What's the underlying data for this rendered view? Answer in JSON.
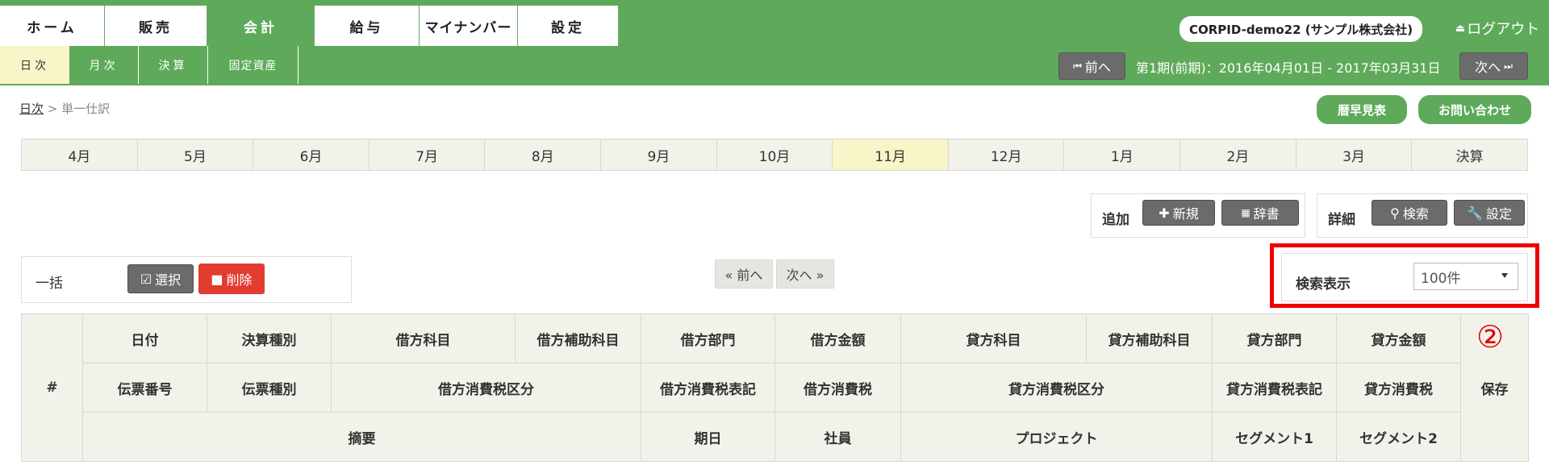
{
  "main_tabs": [
    {
      "label": "ホーム",
      "active": false
    },
    {
      "label": "販売",
      "active": false
    },
    {
      "label": "会計",
      "active": true
    },
    {
      "label": "給与",
      "active": false
    },
    {
      "label": "マイナンバー",
      "active": false
    },
    {
      "label": "設定",
      "active": false
    }
  ],
  "user": "CORPID-demo22 (サンプル株式会社)",
  "logout": "ログアウト",
  "sub_tabs": [
    {
      "label": "日次",
      "active": true
    },
    {
      "label": "月次",
      "active": false
    },
    {
      "label": "決算",
      "active": false
    },
    {
      "label": "固定資産",
      "active": false
    }
  ],
  "period": {
    "prev": "前へ",
    "text": "第1期(前期)：2016年04月01日 - 2017年03月31日",
    "next": "次へ"
  },
  "breadcrumb": {
    "link": "日次",
    "sep": ">",
    "current": "単一仕訳"
  },
  "header_buttons": {
    "calendar": "暦早見表",
    "contact": "お問い合わせ"
  },
  "months": [
    {
      "label": "4月",
      "active": false
    },
    {
      "label": "5月",
      "active": false
    },
    {
      "label": "6月",
      "active": false
    },
    {
      "label": "7月",
      "active": false
    },
    {
      "label": "8月",
      "active": false
    },
    {
      "label": "9月",
      "active": false
    },
    {
      "label": "10月",
      "active": false
    },
    {
      "label": "11月",
      "active": true
    },
    {
      "label": "12月",
      "active": false
    },
    {
      "label": "1月",
      "active": false
    },
    {
      "label": "2月",
      "active": false
    },
    {
      "label": "3月",
      "active": false
    },
    {
      "label": "決算",
      "active": false
    }
  ],
  "add_panel": {
    "label": "追加",
    "new": "新規",
    "dictionary": "辞書"
  },
  "detail_panel": {
    "label": "詳細",
    "search": "検索",
    "settings": "設定"
  },
  "bulk_panel": {
    "label": "一括",
    "select": "選択",
    "delete": "削除"
  },
  "pager": {
    "prev": "« 前へ",
    "next": "次へ »"
  },
  "search_display": {
    "label": "検索表示",
    "value": "100件"
  },
  "annotation": "②",
  "table": {
    "hash": "#",
    "save": "保存",
    "row1": [
      "日付",
      "決算種別",
      "借方科目",
      "借方補助科目",
      "借方部門",
      "借方金額",
      "貸方科目",
      "貸方補助科目",
      "貸方部門",
      "貸方金額"
    ],
    "row2": [
      "伝票番号",
      "伝票種別",
      "借方消費税区分",
      "借方消費税表記",
      "借方消費税",
      "貸方消費税区分",
      "貸方消費税表記",
      "貸方消費税"
    ],
    "row3": [
      "摘要",
      "期日",
      "社員",
      "プロジェクト",
      "セグメント1",
      "セグメント2"
    ]
  }
}
